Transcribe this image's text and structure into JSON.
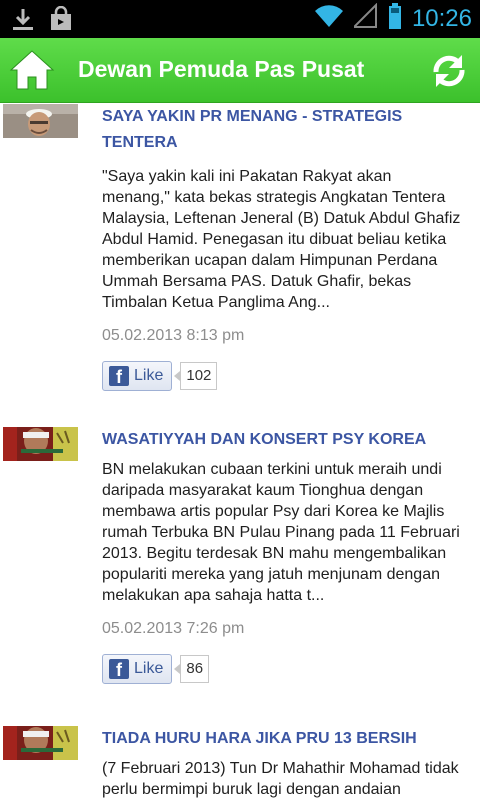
{
  "status": {
    "time": "10:26",
    "left_icons": [
      "download-icon",
      "shopping-bag-icon"
    ],
    "right_icons": [
      "wifi-icon",
      "signal-icon",
      "battery-icon"
    ]
  },
  "appbar": {
    "title": "Dewan Pemuda Pas Pusat",
    "home_icon": "home-icon",
    "refresh_icon": "refresh-icon"
  },
  "articles": [
    {
      "headline": "SAYA YAKIN PR MENANG - STRATEGIS TENTERA",
      "summary": "\"Saya yakin kali ini Pakatan Rakyat akan menang,\" kata bekas strategis Angkatan Tentera Malaysia, Leftenan Jeneral (B) Datuk Abdul Ghafiz Abdul Hamid. Penegasan itu dibuat beliau ketika memberikan ucapan dalam Himpunan Perdana Ummah Bersama PAS. Datuk Ghafir, bekas Timbalan Ketua Panglima Ang...",
      "date": "05.02.2013 8:13 pm",
      "like_label": "Like",
      "like_count": "102"
    },
    {
      "headline": "WASATIYYAH DAN KONSERT PSY KOREA",
      "summary": "BN melakukan cubaan terkini untuk meraih undi daripada masyarakat kaum Tionghua dengan membawa artis popular Psy dari Korea ke Majlis rumah Terbuka BN Pulau Pinang pada 11 Februari 2013. Begitu terdesak BN mahu mengembalikan populariti mereka yang jatuh menjunam dengan melakukan apa sahaja hatta t...",
      "date": "05.02.2013 7:26 pm",
      "like_label": "Like",
      "like_count": "86"
    },
    {
      "headline": "TIADA HURU HARA JIKA PRU 13 BERSIH",
      "summary": "(7 Februari 2013) Tun Dr Mahathir Mohamad tidak perlu bermimpi buruk lagi dengan andaian",
      "date": "",
      "like_label": "",
      "like_count": ""
    }
  ],
  "colors": {
    "appbar": "#3cc12c",
    "headline": "#3c56a3",
    "clock": "#33b5e5",
    "facebook": "#3b5998"
  }
}
